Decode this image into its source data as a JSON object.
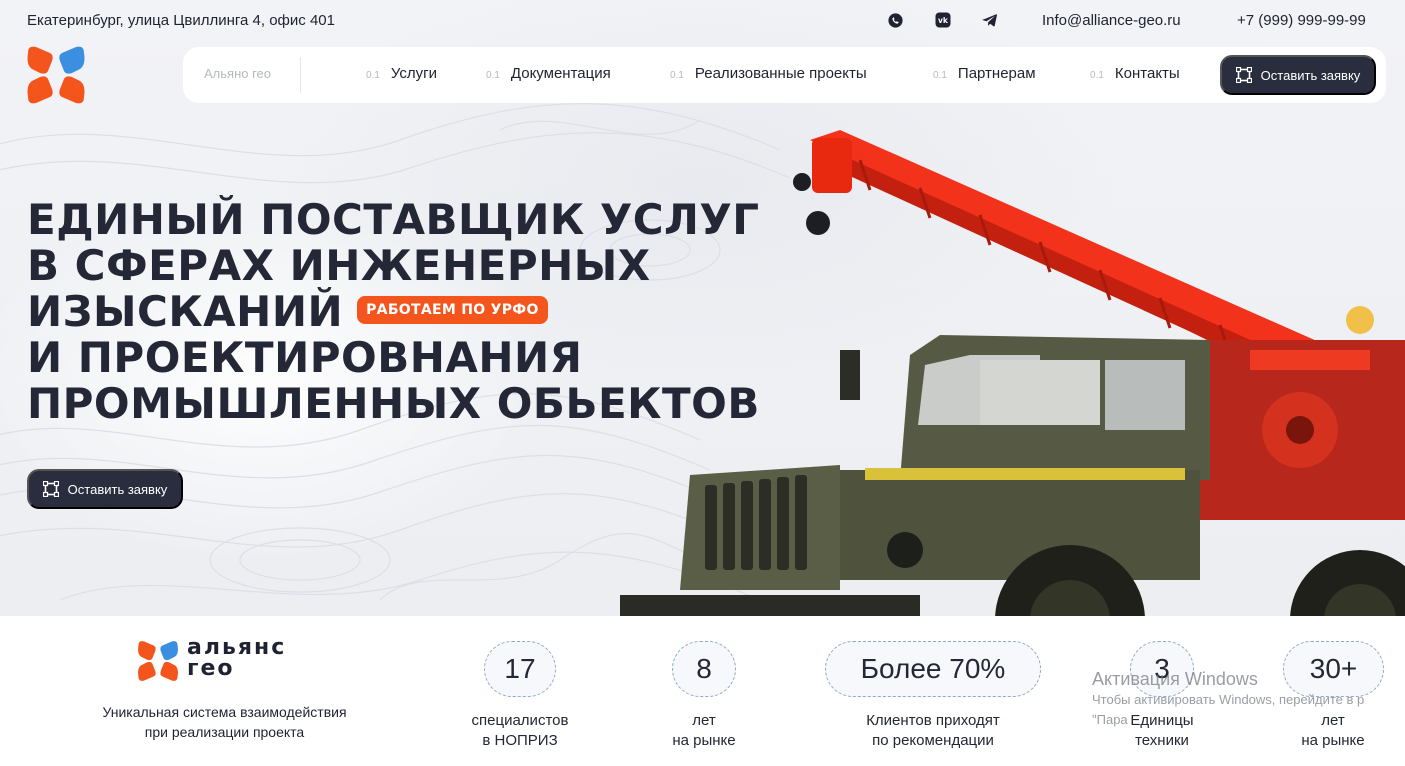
{
  "topbar": {
    "address": "Екатеринбург, улица Цвиллинга 4, офис 401",
    "email": "Info@alliance-geo.ru",
    "phone": "+7 (999) 999-99-99",
    "social_icons": [
      "whatsapp-icon",
      "vk-icon",
      "telegram-icon"
    ]
  },
  "nav": {
    "brand": "Альяно гео",
    "items": [
      {
        "num": "0.1",
        "label": "Услуги"
      },
      {
        "num": "0.1",
        "label": "Документация"
      },
      {
        "num": "0.1",
        "label": "Реализованные проекты"
      },
      {
        "num": "0.1",
        "label": "Партнерам"
      },
      {
        "num": "0.1",
        "label": "Контакты"
      }
    ],
    "cta_label": "Оставить заявку"
  },
  "hero": {
    "headline_lines": [
      "Единый поставщик услуг",
      "в сферах инженерных",
      "изысканий",
      "и проектировнания",
      "промышленных обьектов"
    ],
    "badge": "РАБОТАЕМ ПО УРФО",
    "cta_label": "Оставить заявку"
  },
  "brand": {
    "wordmark_line1": "альянс",
    "wordmark_line2": "гео",
    "description_line1": "Уникальная система взаимодействия",
    "description_line2": "при реализации проекта"
  },
  "stats": [
    {
      "value": "17",
      "line1": "специалистов",
      "line2": "в НОПРИЗ"
    },
    {
      "value": "8",
      "line1": "лет",
      "line2": "на рынке"
    },
    {
      "value": "Более 70%",
      "line1": "Клиентов приходят",
      "line2": "по рекомендации"
    },
    {
      "value": "3",
      "line1": "Единицы",
      "line2": "техники"
    },
    {
      "value": "30+",
      "line1": "лет",
      "line2": "на рынке"
    }
  ],
  "watermark": {
    "title": "Активация Windows",
    "subtitle_line1": "Чтобы активировать Windows, перейдите в р",
    "subtitle_line2": "\"Пара"
  },
  "colors": {
    "accent_orange": "#f4551d",
    "accent_blue": "#3b8fe0",
    "dark": "#2a2d3d"
  }
}
